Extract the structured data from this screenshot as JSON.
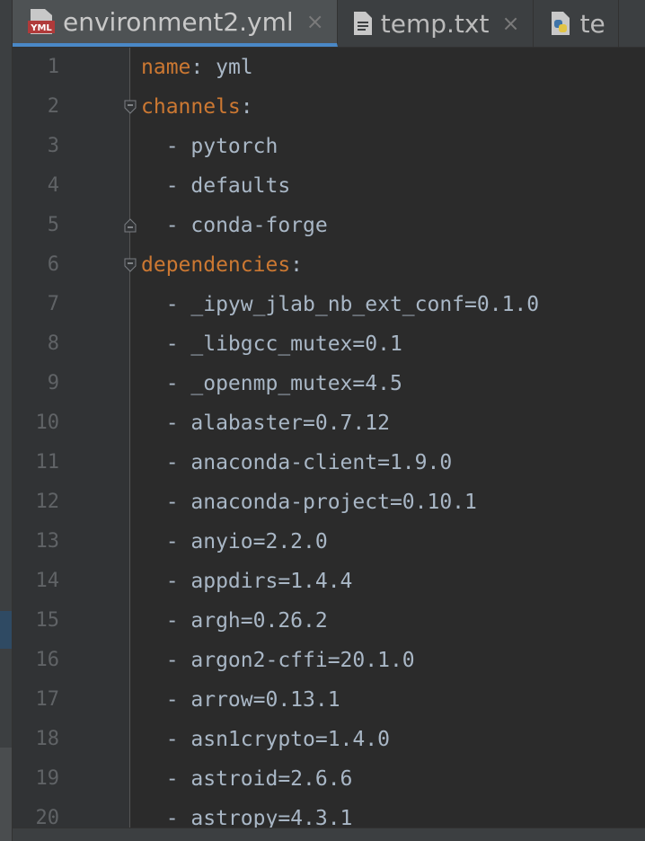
{
  "tabs": [
    {
      "label": "environment2.yml",
      "icon": "yml-file-icon",
      "active": true,
      "closable": true
    },
    {
      "label": "temp.txt",
      "icon": "text-file-icon",
      "active": false,
      "closable": true
    },
    {
      "label": "te",
      "icon": "python-file-icon",
      "active": false,
      "closable": false
    }
  ],
  "tab_close_glyph": "×",
  "yml_icon_text": "YML",
  "lines": [
    {
      "num": "1",
      "key": "name",
      "sep": ":",
      "value": " yml",
      "fold": null
    },
    {
      "num": "2",
      "key": "channels",
      "sep": ":",
      "value": "",
      "fold": "open"
    },
    {
      "num": "3",
      "key": "",
      "sep": "",
      "value": "  - pytorch",
      "fold": null
    },
    {
      "num": "4",
      "key": "",
      "sep": "",
      "value": "  - defaults",
      "fold": null
    },
    {
      "num": "5",
      "key": "",
      "sep": "",
      "value": "  - conda-forge",
      "fold": "end"
    },
    {
      "num": "6",
      "key": "dependencies",
      "sep": ":",
      "value": "",
      "fold": "open"
    },
    {
      "num": "7",
      "key": "",
      "sep": "",
      "value": "  - _ipyw_jlab_nb_ext_conf=0.1.0",
      "fold": null
    },
    {
      "num": "8",
      "key": "",
      "sep": "",
      "value": "  - _libgcc_mutex=0.1",
      "fold": null
    },
    {
      "num": "9",
      "key": "",
      "sep": "",
      "value": "  - _openmp_mutex=4.5",
      "fold": null
    },
    {
      "num": "10",
      "key": "",
      "sep": "",
      "value": "  - alabaster=0.7.12",
      "fold": null
    },
    {
      "num": "11",
      "key": "",
      "sep": "",
      "value": "  - anaconda-client=1.9.0",
      "fold": null
    },
    {
      "num": "12",
      "key": "",
      "sep": "",
      "value": "  - anaconda-project=0.10.1",
      "fold": null
    },
    {
      "num": "13",
      "key": "",
      "sep": "",
      "value": "  - anyio=2.2.0",
      "fold": null
    },
    {
      "num": "14",
      "key": "",
      "sep": "",
      "value": "  - appdirs=1.4.4",
      "fold": null
    },
    {
      "num": "15",
      "key": "",
      "sep": "",
      "value": "  - argh=0.26.2",
      "fold": null
    },
    {
      "num": "16",
      "key": "",
      "sep": "",
      "value": "  - argon2-cffi=20.1.0",
      "fold": null
    },
    {
      "num": "17",
      "key": "",
      "sep": "",
      "value": "  - arrow=0.13.1",
      "fold": null
    },
    {
      "num": "18",
      "key": "",
      "sep": "",
      "value": "  - asn1crypto=1.4.0",
      "fold": null
    },
    {
      "num": "19",
      "key": "",
      "sep": "",
      "value": "  - astroid=2.6.6",
      "fold": null
    },
    {
      "num": "20",
      "key": "",
      "sep": "",
      "value": "  - astropy=4.3.1",
      "fold": null
    }
  ],
  "colors": {
    "background": "#2b2b2b",
    "gutter": "#313335",
    "key": "#cc7832",
    "text": "#a9b7c6",
    "line_number": "#606366",
    "active_tab_underline": "#4a88c7"
  }
}
